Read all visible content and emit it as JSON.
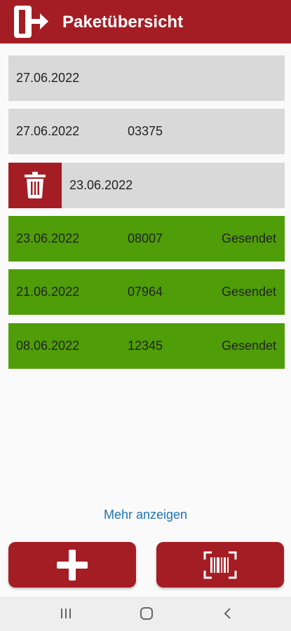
{
  "header": {
    "title": "Paketübersicht",
    "logout_icon": "logout-icon"
  },
  "packages": [
    {
      "date": "27.06.2022",
      "number": "",
      "status": "",
      "state": "pending"
    },
    {
      "date": "27.06.2022",
      "number": "03375",
      "status": "",
      "state": "pending"
    },
    {
      "date": "23.06.2022",
      "number": "",
      "status": "",
      "state": "pending",
      "swiped": true,
      "action_icon": "trash-icon"
    },
    {
      "date": "23.06.2022",
      "number": "08007",
      "status": "Gesendet",
      "state": "sent"
    },
    {
      "date": "21.06.2022",
      "number": "07964",
      "status": "Gesendet",
      "state": "sent"
    },
    {
      "date": "08.06.2022",
      "number": "12345",
      "status": "Gesendet",
      "state": "sent"
    }
  ],
  "more_link": "Mehr anzeigen",
  "actions": {
    "add_icon": "plus-icon",
    "scan_icon": "barcode-scan-icon"
  },
  "system_nav": {
    "recents_icon": "recents-icon",
    "home_icon": "home-icon",
    "back_icon": "back-icon"
  },
  "colors": {
    "brand": "#a51d24",
    "pending_row": "#d9d9d9",
    "sent_row": "#4f9d08",
    "link": "#1f73b7"
  }
}
